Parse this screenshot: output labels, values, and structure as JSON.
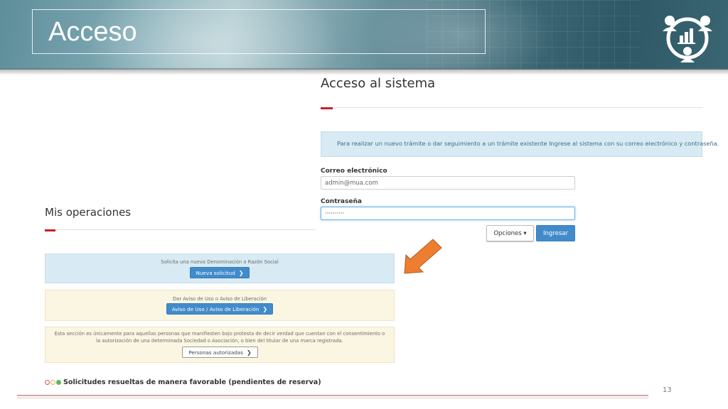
{
  "slide": {
    "title": "Acceso",
    "page_number": "13"
  },
  "login": {
    "title": "Acceso al sistema",
    "info": "Para realizar un nuevo trámite o dar seguimiento a un trámite existente Ingrese al sistema con su correo electrónico y contraseña.",
    "email_label": "Correo electrónico",
    "email_value": "admin@mua.com",
    "password_label": "Contraseña",
    "password_value": "··········",
    "options_button": "Opciones ▾",
    "submit_button": "Ingresar"
  },
  "operations": {
    "title": "Mis operaciones",
    "panels": [
      {
        "text": "Solicita una nueva Denominación o Razón Social",
        "button": "Nueva solicitud"
      },
      {
        "text": "Dar Aviso de Uso o Aviso de Liberación",
        "button": "Aviso de Uso / Aviso de Liberación"
      },
      {
        "text_line1": "Esta sección es únicamente para aquellas personas que manifiesten bajo protesta de decir verdad que cuentan con el consentimiento o",
        "text_line2": "la autorización de una determinada Sociedad o Asociación, o bien del titular de una marca registrada.",
        "button": "Personas autorizadas"
      }
    ],
    "status_text": "Solicitudes resueltas de manera favorable (pendientes de reserva)"
  },
  "colors": {
    "accent_red": "#c7202a",
    "primary_blue": "#428bca",
    "arrow_orange": "#ed7d31",
    "dot_red": "#d9534f",
    "dot_yellow": "#f0ad4e",
    "dot_green": "#5cb85c"
  },
  "icons": {
    "logo": "people-chart-logo-icon",
    "chevron": "chevron-right-icon",
    "arrow": "pointer-arrow-icon"
  }
}
